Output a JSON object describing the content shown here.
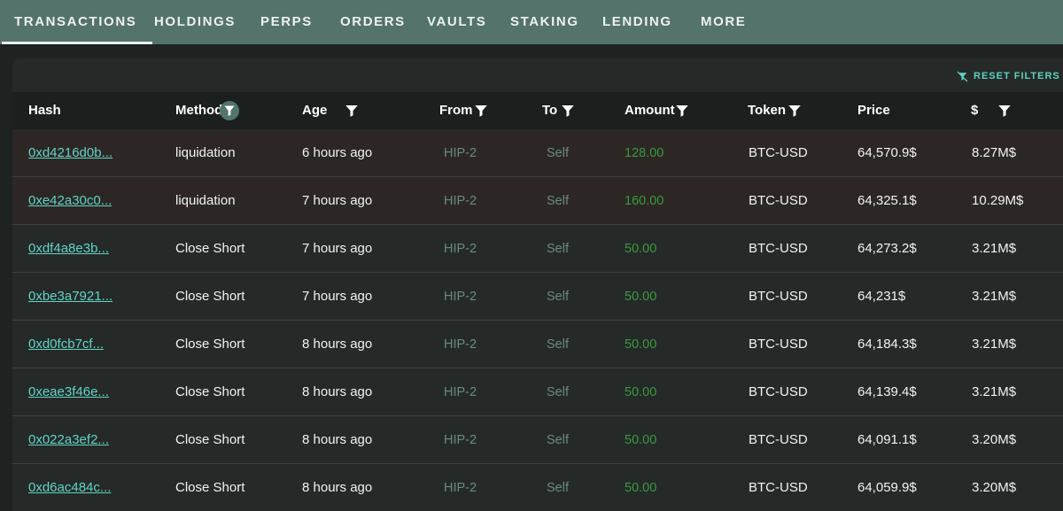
{
  "nav": {
    "tabs": [
      "TRANSACTIONS",
      "HOLDINGS",
      "PERPS",
      "ORDERS",
      "VAULTS",
      "STAKING",
      "LENDING",
      "MORE"
    ],
    "active": "TRANSACTIONS"
  },
  "toolbar": {
    "reset_label": "RESET FILTERS"
  },
  "table": {
    "headers": {
      "hash": "Hash",
      "method": "Method",
      "age": "Age",
      "from": "From",
      "to": "To",
      "amount": "Amount",
      "token": "Token",
      "price": "Price",
      "usd": "$"
    },
    "rows": [
      {
        "hash": "0xd4216d0b...",
        "method": "liquidation",
        "age": "6 hours ago",
        "from": "HIP-2",
        "to": "Self",
        "amount": "128.00",
        "token": "BTC-USD",
        "price": "64,570.9$",
        "usd": "8.27M$"
      },
      {
        "hash": "0xe42a30c0...",
        "method": "liquidation",
        "age": "7 hours ago",
        "from": "HIP-2",
        "to": "Self",
        "amount": "160.00",
        "token": "BTC-USD",
        "price": "64,325.1$",
        "usd": "10.29M$"
      },
      {
        "hash": "0xdf4a8e3b...",
        "method": "Close Short",
        "age": "7 hours ago",
        "from": "HIP-2",
        "to": "Self",
        "amount": "50.00",
        "token": "BTC-USD",
        "price": "64,273.2$",
        "usd": "3.21M$"
      },
      {
        "hash": "0xbe3a7921...",
        "method": "Close Short",
        "age": "7 hours ago",
        "from": "HIP-2",
        "to": "Self",
        "amount": "50.00",
        "token": "BTC-USD",
        "price": "64,231$",
        "usd": "3.21M$"
      },
      {
        "hash": "0xd0fcb7cf...",
        "method": "Close Short",
        "age": "8 hours ago",
        "from": "HIP-2",
        "to": "Self",
        "amount": "50.00",
        "token": "BTC-USD",
        "price": "64,184.3$",
        "usd": "3.21M$"
      },
      {
        "hash": "0xeae3f46e...",
        "method": "Close Short",
        "age": "8 hours ago",
        "from": "HIP-2",
        "to": "Self",
        "amount": "50.00",
        "token": "BTC-USD",
        "price": "64,139.4$",
        "usd": "3.21M$"
      },
      {
        "hash": "0x022a3ef2...",
        "method": "Close Short",
        "age": "8 hours ago",
        "from": "HIP-2",
        "to": "Self",
        "amount": "50.00",
        "token": "BTC-USD",
        "price": "64,091.1$",
        "usd": "3.20M$"
      },
      {
        "hash": "0xd6ac484c...",
        "method": "Close Short",
        "age": "8 hours ago",
        "from": "HIP-2",
        "to": "Self",
        "amount": "50.00",
        "token": "BTC-USD",
        "price": "64,059.9$",
        "usd": "3.20M$"
      }
    ]
  },
  "colors": {
    "nav_bg": "#54736a",
    "hash_link": "#62d3c3",
    "amount_green": "#3a9a3c",
    "liquidation_row": "#2c2725"
  }
}
